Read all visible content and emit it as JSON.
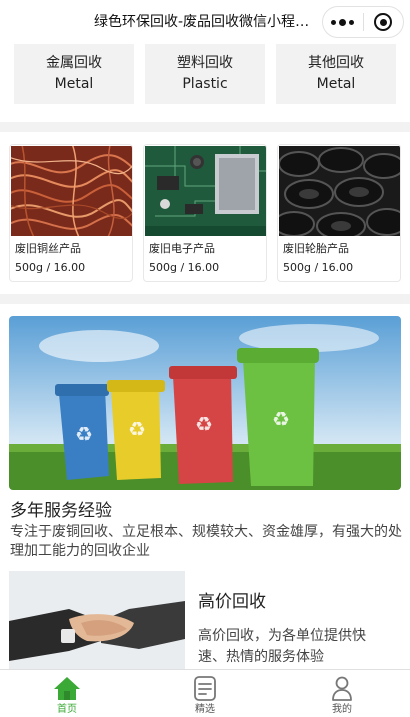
{
  "header": {
    "title": "绿色环保回收-废品回收微信小程序模..."
  },
  "categories": [
    {
      "zh": "金属回收",
      "en": "Metal"
    },
    {
      "zh": "塑料回收",
      "en": "Plastic"
    },
    {
      "zh": "其他回收",
      "en": "Metal"
    }
  ],
  "products": [
    {
      "name": "废旧铜丝产品",
      "price": "500g / 16.00"
    },
    {
      "name": "废旧电子产品",
      "price": "500g / 16.00"
    },
    {
      "name": "废旧轮胎产品",
      "price": "500g / 16.00"
    }
  ],
  "sections": {
    "experience": {
      "title": "多年服务经验",
      "desc": "专注于废铜回收、立足根本、规模较大、资金雄厚，有强大的处理加工能力的回收企业"
    },
    "high_price": {
      "title": "高价回收",
      "desc": "高价回收，为各单位提供快速、热情的服务体验"
    }
  },
  "tabbar": {
    "items": [
      {
        "label": "首页",
        "icon": "home-icon",
        "active": true
      },
      {
        "label": "精选",
        "icon": "document-icon",
        "active": false
      },
      {
        "label": "我的",
        "icon": "user-icon",
        "active": false
      }
    ]
  },
  "colors": {
    "accent": "#3aa935",
    "tile_bg": "#f2f2f2",
    "separator": "#f2f2f2"
  }
}
